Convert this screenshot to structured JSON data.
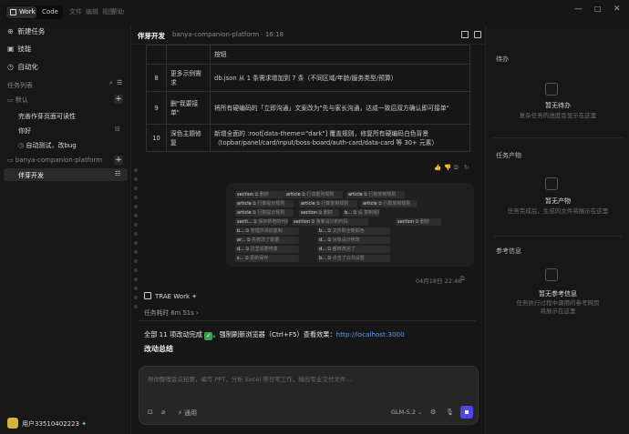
{
  "topbar": {
    "tab_work": "Work",
    "tab_code": "Code",
    "menu": [
      "文件",
      "编辑",
      "视图",
      "帮助"
    ]
  },
  "sidebar": {
    "new_task": "新建任务",
    "skills": "技能",
    "automation": "自动化",
    "task_list_title": "任务列表",
    "group_default": "默认",
    "tasks": [
      "完善作芽页面可读性",
      "你好",
      "自动测试，改bug"
    ],
    "group_project": "banya-companion-platform",
    "active_task": "伴芽开发",
    "user": "用户33510402223"
  },
  "main": {
    "header_title": "伴芽开发",
    "header_meta": "banya-companion-platform · 16:18",
    "table": [
      {
        "n": "",
        "what": "",
        "detail": "按钮"
      },
      {
        "n": "8",
        "what": "更多示例需求",
        "detail": "db.json 从 1 条需求增加到 7 条（不同区域/年龄/服务类型/预算）"
      },
      {
        "n": "9",
        "what": "删\"我要接单\"",
        "detail": "将所有硬编码的「立即沟通」文案改为\"先与家长沟通，达成一致后双方确认即可接单\""
      },
      {
        "n": "10",
        "what": "深色主题修复",
        "detail": "新增全面的 :root[data-theme=\"dark\"] 覆盖规则，修复所有硬编码白色背景（topbar/panel/card/input/boss-board/auth-card/data-card 等 30+ 元素）"
      }
    ],
    "tool_chips": [
      [
        "section",
        "删掉"
      ],
      [
        "article",
        "行双重列规则"
      ],
      [
        "article",
        "行数复制规则"
      ],
      [
        "article",
        "行数提示规则"
      ],
      [
        "article",
        "行数复制规则"
      ],
      [
        "article",
        "行数复制规则"
      ],
      [
        "article",
        "行数提示规则"
      ],
      [
        "section",
        "删掉"
      ],
      [
        "b...",
        "设 复制规则"
      ],
      [
        "secti...",
        "保存新增的代码"
      ],
      [
        "section",
        "量新设计的代码"
      ],
      [
        "section",
        "删掉"
      ],
      [
        "b...",
        "管理并添加复制"
      ],
      [
        "b...",
        "文件取全新颜色"
      ],
      [
        "ar...",
        "先修改了数据"
      ],
      [
        "d...",
        "对象设计修改"
      ],
      [
        "d...",
        "这里需要修复"
      ],
      [
        "d...",
        "都修改完了"
      ],
      [
        "s...",
        "更新保存"
      ],
      [
        "b...",
        "点击了公共设置"
      ]
    ],
    "msg_time": "04月18日 22:46",
    "agent_name": "TRAE Work",
    "duration": "任务耗时 6m 51s",
    "done_prefix": "全部 11 项改动完成 ",
    "done_mid": "。强制刷新浏览器（Ctrl+F5）查看效果：",
    "done_link": "http://localhost:3000",
    "summary_title": "改动总结",
    "composer_placeholder": "帮你整理会议纪要，编写 PPT，分析 Excel 等日常工作，输出专业交付文件...",
    "composer_mode": "通用",
    "composer_model": "GLM-5.2"
  },
  "right": {
    "todo_title": "待办",
    "todo_empty": "暂无待办",
    "todo_hint": "复杂任务的进度会显示在这里",
    "output_title": "任务产物",
    "output_empty": "暂无产物",
    "output_hint": "任务完成后，生成的文件将展示在这里",
    "ref_title": "参考信息",
    "ref_empty": "暂无参考信息",
    "ref_hint1": "任务执行过程中调用的参考网页",
    "ref_hint2": "将展示在这里"
  }
}
